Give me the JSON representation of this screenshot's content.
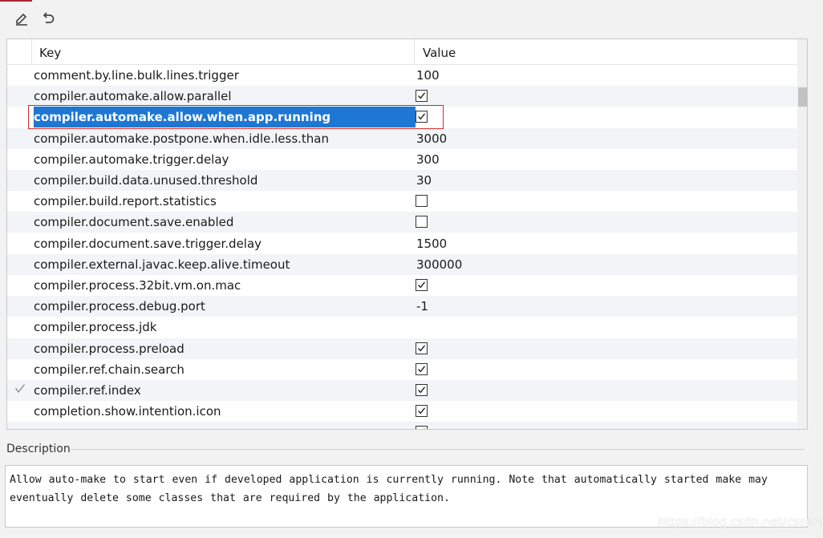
{
  "toolbar": {
    "edit_icon": "pencil-icon",
    "undo_icon": "undo-icon"
  },
  "table": {
    "columns": {
      "key": "Key",
      "value": "Value"
    },
    "rows": [
      {
        "key": "comment.by.line.bulk.lines.trigger",
        "type": "text",
        "value": "100"
      },
      {
        "key": "compiler.automake.allow.parallel",
        "type": "checkbox",
        "checked": true
      },
      {
        "key": "compiler.automake.allow.when.app.running",
        "type": "checkbox",
        "checked": true,
        "selected": true
      },
      {
        "key": "compiler.automake.postpone.when.idle.less.than",
        "type": "text",
        "value": "3000"
      },
      {
        "key": "compiler.automake.trigger.delay",
        "type": "text",
        "value": "300"
      },
      {
        "key": "compiler.build.data.unused.threshold",
        "type": "text",
        "value": "30"
      },
      {
        "key": "compiler.build.report.statistics",
        "type": "checkbox",
        "checked": false
      },
      {
        "key": "compiler.document.save.enabled",
        "type": "checkbox",
        "checked": false
      },
      {
        "key": "compiler.document.save.trigger.delay",
        "type": "text",
        "value": "1500"
      },
      {
        "key": "compiler.external.javac.keep.alive.timeout",
        "type": "text",
        "value": "300000"
      },
      {
        "key": "compiler.process.32bit.vm.on.mac",
        "type": "checkbox",
        "checked": true
      },
      {
        "key": "compiler.process.debug.port",
        "type": "text",
        "value": "-1"
      },
      {
        "key": "compiler.process.jdk",
        "type": "text",
        "value": ""
      },
      {
        "key": "compiler.process.preload",
        "type": "checkbox",
        "checked": true
      },
      {
        "key": "compiler.ref.chain.search",
        "type": "checkbox",
        "checked": true
      },
      {
        "key": "compiler.ref.index",
        "type": "checkbox",
        "checked": true,
        "modified": true
      },
      {
        "key": "completion.show.intention.icon",
        "type": "checkbox",
        "checked": true
      },
      {
        "key": "",
        "type": "checkbox",
        "checked": true
      }
    ]
  },
  "description": {
    "label": "Description",
    "text": "Allow auto-make to start even if developed application is currently running. Note that automatically started make may eventually delete some classes that are required by the application."
  },
  "watermark": "https://blog.csdn.net/cssnnd"
}
